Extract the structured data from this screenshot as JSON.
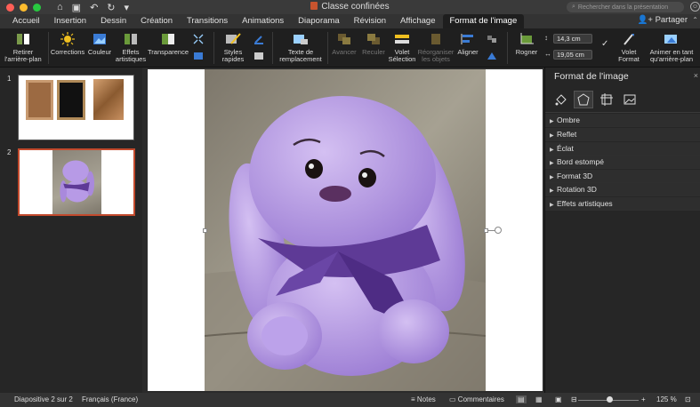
{
  "window": {
    "title": "Classe confinées",
    "search_placeholder": "Rechercher dans la présentation"
  },
  "tabs": [
    {
      "label": "Accueil"
    },
    {
      "label": "Insertion"
    },
    {
      "label": "Dessin"
    },
    {
      "label": "Création"
    },
    {
      "label": "Transitions"
    },
    {
      "label": "Animations"
    },
    {
      "label": "Diaporama"
    },
    {
      "label": "Révision"
    },
    {
      "label": "Affichage"
    },
    {
      "label": "Format de l'image"
    }
  ],
  "share_label": "Partager",
  "ribbon": {
    "remove_bg": "Retirer l'arrière-plan",
    "corrections": "Corrections",
    "color": "Couleur",
    "artistic_effects": "Effets artistiques",
    "transparency": "Transparence",
    "quick_styles": "Styles rapides",
    "alt_text": "Texte de remplacement",
    "bring_forward": "Avancer",
    "send_backward": "Reculer",
    "selection_pane": "Volet Sélection",
    "reorder": "Réorganiser les objets",
    "align": "Aligner",
    "crop": "Rogner",
    "height": "14,3 cm",
    "width": "19,05 cm",
    "format_pane": "Volet Format",
    "animate_bg": "Animer en tant qu'arrière-plan"
  },
  "thumbnails": [
    {
      "number": "1"
    },
    {
      "number": "2"
    }
  ],
  "pane": {
    "title": "Format de l'image",
    "items": [
      {
        "label": "Ombre"
      },
      {
        "label": "Reflet"
      },
      {
        "label": "Éclat"
      },
      {
        "label": "Bord estompé"
      },
      {
        "label": "Format 3D"
      },
      {
        "label": "Rotation 3D"
      },
      {
        "label": "Effets artistiques"
      }
    ]
  },
  "status": {
    "slide": "Diapositive 2 sur 2",
    "language": "Français (France)",
    "notes": "Notes",
    "comments": "Commentaires",
    "zoom": "125 %",
    "zoom_fraction": 0.52
  },
  "colors": {
    "accent": "#c24a2d",
    "bunny": "#b79ae6",
    "ribbon_bow": "#5e3a96"
  }
}
